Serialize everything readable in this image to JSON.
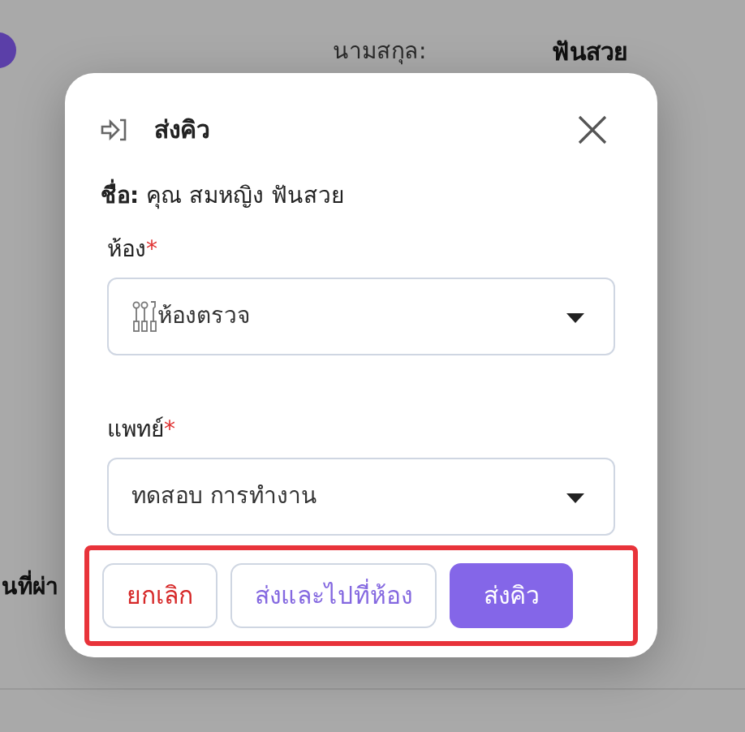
{
  "background": {
    "surname_label": "นามสกุล:",
    "surname_value": "ฟันสวย",
    "row_label": "นที่ผ่า"
  },
  "dialog": {
    "title": "ส่งคิว",
    "name_line": "**ชื่อ:** คุณ สมหญิง ฟันสวย",
    "fields": [
      {
        "label": "ห้อง",
        "required_mark": "*",
        "value": "ห้องตรวจ",
        "has_icon": true
      },
      {
        "label": "แพทย์",
        "required_mark": "*",
        "value": "ทดสอบ การทำงาน",
        "has_icon": false
      }
    ],
    "buttons": [
      {
        "label": "ยกเลิก",
        "kind": "cancel"
      },
      {
        "label": "ส่งและไปที่ห้อง",
        "kind": "secondary"
      },
      {
        "label": "ส่งคิว",
        "kind": "primary"
      }
    ],
    "footer_highlighted": true
  }
}
